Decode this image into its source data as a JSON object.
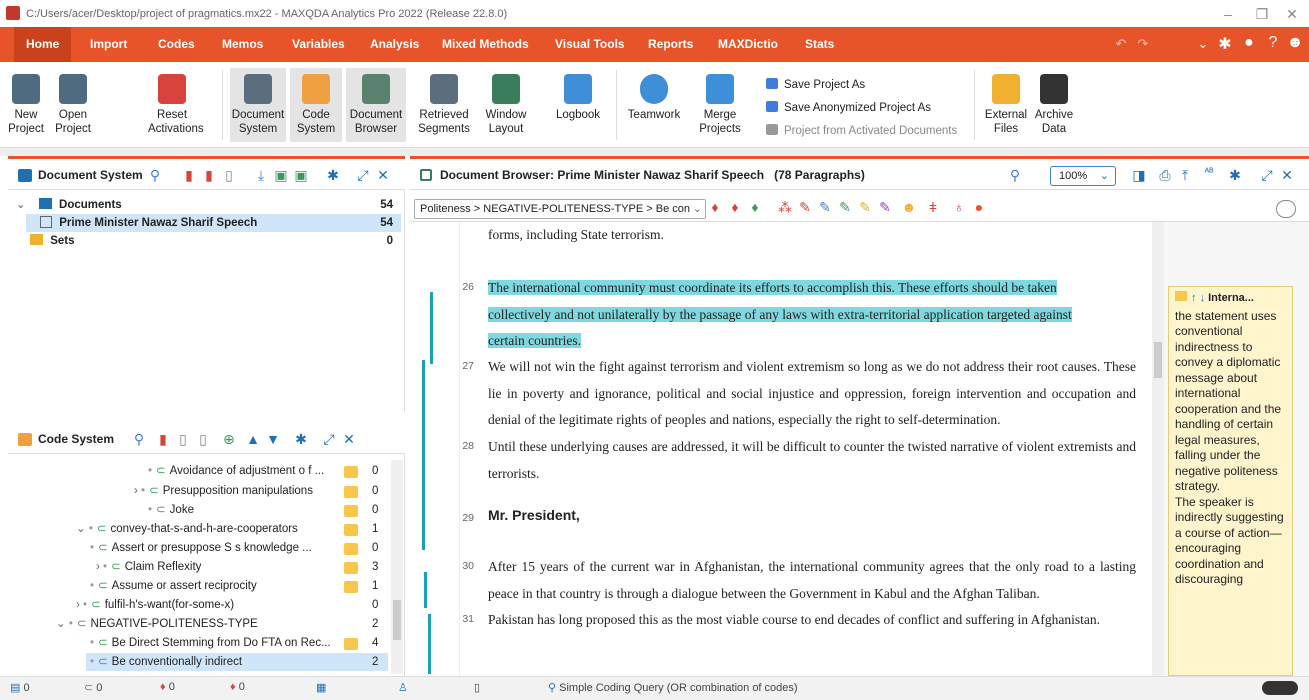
{
  "window": {
    "title": "C:/Users/acer/Desktop/project of pragmatics.mx22 - MAXQDA Analytics Pro 2022 (Release 22.8.0)"
  },
  "menu": {
    "tabs": [
      "Home",
      "Import",
      "Codes",
      "Memos",
      "Variables",
      "Analysis",
      "Mixed Methods",
      "Visual Tools",
      "Reports",
      "MAXDictio",
      "Stats"
    ]
  },
  "ribbon": {
    "new_project": [
      "New",
      "Project"
    ],
    "open_project": [
      "Open",
      "Project"
    ],
    "reset_activations": [
      "Reset",
      "Activations"
    ],
    "document_system": [
      "Document",
      "System"
    ],
    "code_system": [
      "Code",
      "System"
    ],
    "document_browser": [
      "Document",
      "Browser"
    ],
    "retrieved_segments": [
      "Retrieved",
      "Segments"
    ],
    "window_layout": [
      "Window",
      "Layout"
    ],
    "logbook": "Logbook",
    "teamwork": "Teamwork",
    "merge_projects": [
      "Merge",
      "Projects"
    ],
    "save_project_as": "Save Project As",
    "save_anonymized": "Save Anonymized Project As",
    "project_from_activated": "Project from Activated Documents",
    "external_files": [
      "External",
      "Files"
    ],
    "archive_data": [
      "Archive",
      "Data"
    ]
  },
  "document_system": {
    "title": "Document System",
    "rows": [
      {
        "label": "Documents",
        "count": "54"
      },
      {
        "label": "Prime Minister Nawaz Sharif Speech",
        "count": "54"
      },
      {
        "label": "Sets",
        "count": "0"
      }
    ]
  },
  "code_system": {
    "title": "Code System",
    "rows": [
      {
        "label": "Avoidance of adjustment o f ...",
        "count": "0"
      },
      {
        "label": "Presupposition manipulations",
        "count": "0"
      },
      {
        "label": "Joke",
        "count": "0"
      },
      {
        "label": "convey-that-s-and-h-are-cooperators",
        "count": "1"
      },
      {
        "label": "Assert or presuppose S s knowledge ...",
        "count": "0"
      },
      {
        "label": "Claim Reflexity",
        "count": "3"
      },
      {
        "label": "Assume or assert reciprocity",
        "count": "1"
      },
      {
        "label": "fulfil-h's-want(for-some-x)",
        "count": "0"
      },
      {
        "label": "NEGATIVE-POLITENESS-TYPE",
        "count": "2"
      },
      {
        "label": "Be Direct Stemming from Do FTA on Rec...",
        "count": "4"
      },
      {
        "label": "Be conventionally indirect",
        "count": "2"
      }
    ]
  },
  "browser": {
    "title": "Document Browser: Prime Minister Nawaz Sharif Speech",
    "paragraphs_count": "(78 Paragraphs)",
    "zoom": "100%",
    "code_combo": "Politeness > NEGATIVE-POLITENESS-TYPE > Be conv",
    "p_prev": "forms, including State terrorism.",
    "p26_num": "26",
    "p26_l1": "The international community must coordinate its efforts to accomplish this. These efforts should be taken",
    "p26_l2": "collectively and not unilaterally by the passage of any laws with extra-territorial application targeted against",
    "p26_l3": "certain countries.",
    "p27_num": "27",
    "p27": "We will not win the fight against terrorism and violent extremism so long as we do not address their root causes. These lie in poverty and ignorance, political and social injustice and oppression, foreign intervention and occupation and denial of the legitimate rights of peoples and nations, especially the right to self-determination.",
    "p28_num": "28",
    "p28": "Until these underlying causes are addressed, it will be difficult to counter the twisted narrative of violent extremists and terrorists.",
    "p29_num": "29",
    "p29": "Mr. President,",
    "p30_num": "30",
    "p30": "After 15 years of the current war in Afghanistan, the international community agrees that the only road to a lasting peace in that country is through a dialogue between the Government in Kabul and the Afghan Taliban.",
    "p31_num": "31",
    "p31": "Pakistan has long proposed this as the most viable course to end decades of conflict and suffering in Afghanistan.",
    "comment_header": "Interna...",
    "comment_text": "the statement uses conventional indirectness to convey a diplomatic message about international cooperation and the handling of certain legal measures, falling under the negative politeness strategy.\nThe speaker is indirectly suggesting a course of action—encouraging coordination and discouraging"
  },
  "status": {
    "docs": "0",
    "codes": "0",
    "activated": "0",
    "act2": "0",
    "query": "Simple Coding Query (OR combination of codes)"
  }
}
